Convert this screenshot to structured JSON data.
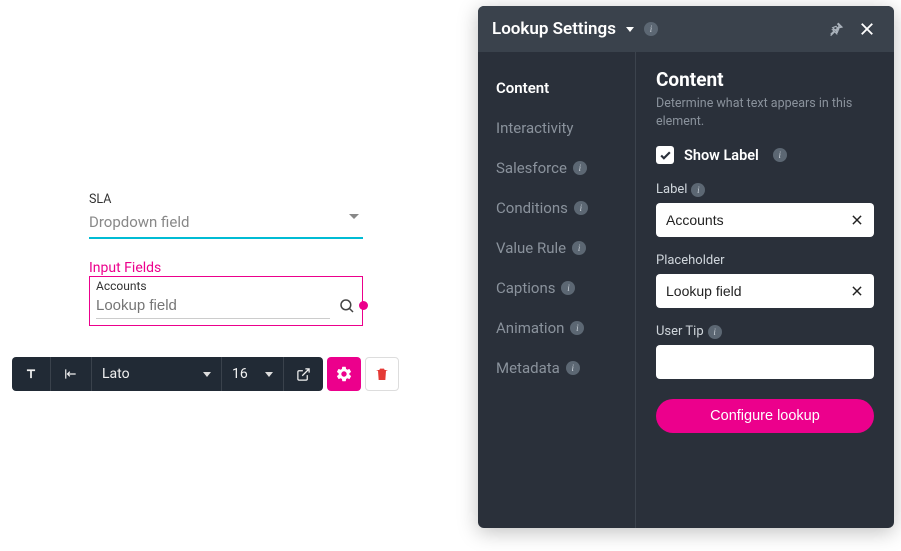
{
  "canvas": {
    "sla_label": "SLA",
    "dropdown_placeholder": "Dropdown field",
    "input_fields_label": "Input Fields",
    "lookup_label": "Accounts",
    "lookup_placeholder": "Lookup field"
  },
  "toolbar": {
    "font": "Lato",
    "size": "16"
  },
  "panel": {
    "title": "Lookup Settings",
    "nav": [
      {
        "label": "Content",
        "badge": false,
        "active": true
      },
      {
        "label": "Interactivity",
        "badge": false,
        "active": false
      },
      {
        "label": "Salesforce",
        "badge": true,
        "active": false
      },
      {
        "label": "Conditions",
        "badge": true,
        "active": false
      },
      {
        "label": "Value Rule",
        "badge": true,
        "active": false
      },
      {
        "label": "Captions",
        "badge": true,
        "active": false
      },
      {
        "label": "Animation",
        "badge": true,
        "active": false
      },
      {
        "label": "Metadata",
        "badge": true,
        "active": false
      }
    ],
    "content": {
      "title": "Content",
      "subtitle": "Determine what text appears in this element.",
      "show_label_text": "Show Label",
      "show_label_checked": true,
      "label_field_label": "Label",
      "label_value": "Accounts",
      "placeholder_field_label": "Placeholder",
      "placeholder_value": "Lookup field",
      "usertip_field_label": "User Tip",
      "usertip_value": "",
      "configure_button": "Configure lookup"
    }
  }
}
